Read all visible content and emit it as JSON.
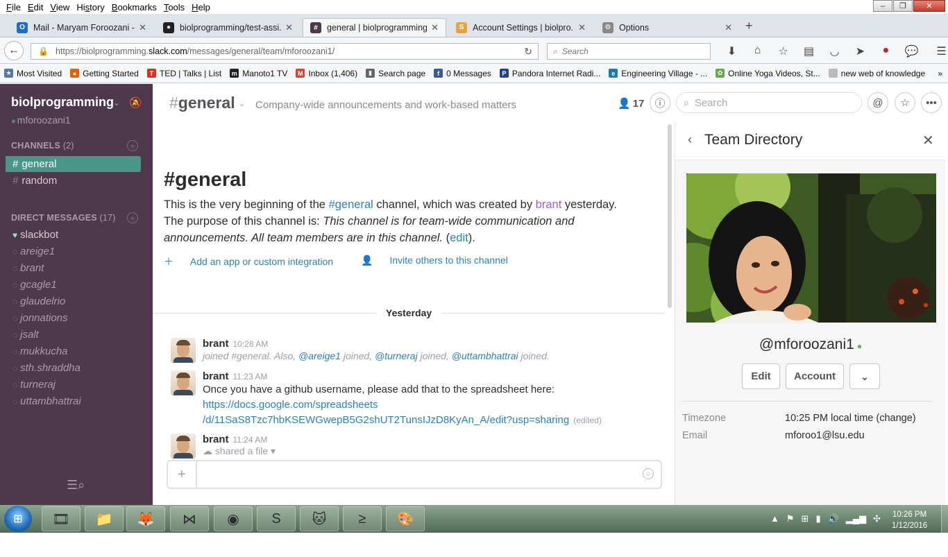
{
  "menubar": {
    "items": [
      {
        "pre": "",
        "u": "F",
        "post": "ile"
      },
      {
        "pre": "",
        "u": "E",
        "post": "dit"
      },
      {
        "pre": "",
        "u": "V",
        "post": "iew"
      },
      {
        "pre": "Hi",
        "u": "s",
        "post": "tory"
      },
      {
        "pre": "",
        "u": "B",
        "post": "ookmarks"
      },
      {
        "pre": "",
        "u": "T",
        "post": "ools"
      },
      {
        "pre": "",
        "u": "H",
        "post": "elp"
      }
    ]
  },
  "tabs": [
    {
      "label": "Mail - Maryam Foroozani -...",
      "icon": "outlook-icon",
      "color": "#1e6ec8",
      "glyph": "O"
    },
    {
      "label": "biolprogramming/test-assi...",
      "icon": "github-icon",
      "color": "#222222",
      "glyph": "●"
    },
    {
      "label": "general | biolprogramming...",
      "icon": "slack-icon",
      "color": "#4d394b",
      "glyph": "#"
    },
    {
      "label": "Account Settings | biolpro...",
      "icon": "slack-account-icon",
      "color": "#e8a33c",
      "glyph": "S"
    },
    {
      "label": "Options",
      "icon": "gear-icon",
      "color": "#888888",
      "glyph": "⚙"
    }
  ],
  "nav": {
    "url_prefix": "https://biolprogramming.",
    "url_domain": "slack.com",
    "url_suffix": "/messages/general/team/mforoozani1/",
    "search_placeholder": "Search"
  },
  "bookmarks": [
    {
      "label": "Most Visited",
      "color": "#5577aa",
      "glyph": "★"
    },
    {
      "label": "Getting Started",
      "color": "#e66000",
      "glyph": "●"
    },
    {
      "label": "TED | Talks | List",
      "color": "#e62b1e",
      "glyph": "T"
    },
    {
      "label": "Manoto1 TV",
      "color": "#222222",
      "glyph": "m"
    },
    {
      "label": "Inbox (1,406)",
      "color": "#d44638",
      "glyph": "M"
    },
    {
      "label": "Search page",
      "color": "#666666",
      "glyph": "▮"
    },
    {
      "label": "0 Messages",
      "color": "#3b5998",
      "glyph": "f"
    },
    {
      "label": "Pandora Internet Radi...",
      "color": "#224099",
      "glyph": "P"
    },
    {
      "label": "Engineering Village - ...",
      "color": "#1a7ab8",
      "glyph": "e"
    },
    {
      "label": "Online Yoga Videos, St...",
      "color": "#6aa84f",
      "glyph": "✿"
    },
    {
      "label": "new web of knowledge",
      "color": "#bbbbbb",
      "glyph": ""
    }
  ],
  "sidebar": {
    "team_name": "biolprogramming",
    "user": "mforoozani1",
    "channels_title": "CHANNELS",
    "channels_count": "(2)",
    "channels": [
      "general",
      "random"
    ],
    "dm_title": "DIRECT MESSAGES",
    "dm_count": "(17)",
    "dms": [
      "slackbot",
      "areige1",
      "brant",
      "gcagle1",
      "glaudelrio",
      "jonnations",
      "jsalt",
      "mukkucha",
      "sth.shraddha",
      "turneraj",
      "uttambhattrai"
    ]
  },
  "channel": {
    "name": "general",
    "purpose": "Company-wide announcements and work-based matters",
    "members": "17",
    "search_placeholder": "Search"
  },
  "intro": {
    "title": "#general",
    "line1_a": "This is the very beginning of the ",
    "line1_link": "#general",
    "line1_b": " channel, which was created by ",
    "line1_user": "brant",
    "line1_c": " yesterday.",
    "purpose_label": "The purpose of this channel is: ",
    "purpose_text": "This channel is for team-wide communication and announcements. All team members are in this channel.",
    "edit_open": " (",
    "edit": "edit",
    "edit_close": ").",
    "add_app": "Add an app or custom integration",
    "invite": "Invite others to this channel"
  },
  "day_divider": "Yesterday",
  "messages": [
    {
      "author": "brant",
      "time": "10:28 AM",
      "join_a": "joined #general. Also, ",
      "m1": "@areige1",
      "j2": " joined, ",
      "m2": "@turneraj",
      "j3": " joined, ",
      "m3": "@uttambhattrai",
      "j4": " joined."
    },
    {
      "author": "brant",
      "time": "11:23 AM",
      "text": "Once you have a github username, please add that to the spreadsheet here:",
      "link1": "https://docs.google.com/spreadsheets",
      "link2": "/d/11SaS8Tzc7hbKSEWGwepB5G2shUT2TunsIJzD8KyAn_A/edit?usp=sharing",
      "edited": "(edited)"
    },
    {
      "author": "brant",
      "time": "11:24 AM",
      "shared": "shared a file"
    }
  ],
  "panel": {
    "title": "Team Directory",
    "handle": "@mforoozani1",
    "buttons": [
      "Edit",
      "Account"
    ],
    "timezone_label": "Timezone",
    "timezone_value": "10:25 PM local time (change)",
    "email_label": "Email",
    "email_value": "mforoo1@lsu.edu"
  },
  "taskbar": {
    "time": "10:26 PM",
    "date": "1/12/2016"
  }
}
